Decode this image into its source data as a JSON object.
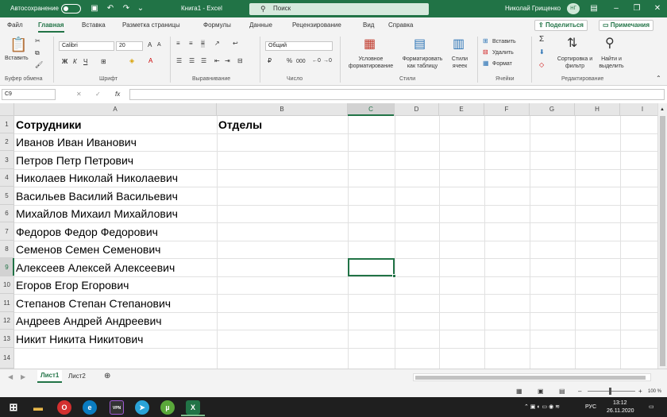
{
  "titlebar": {
    "autosave_label": "Автосохранение",
    "doc_title": "Книга1  -  Excel",
    "search_placeholder": "Поиск",
    "user_name": "Николай Грищенко",
    "user_initials": "НГ"
  },
  "tabs": [
    "Файл",
    "Главная",
    "Вставка",
    "Разметка страницы",
    "Формулы",
    "Данные",
    "Рецензирование",
    "Вид",
    "Справка"
  ],
  "active_tab": "Главная",
  "share_button": "Поделиться",
  "comments_button": "Примечания",
  "ribbon": {
    "clipboard": {
      "paste_label": "Вставить",
      "group_label": "Буфер обмена"
    },
    "font": {
      "name": "Calibri",
      "size": "20",
      "bold": "Ж",
      "italic": "К",
      "underline": "Ч",
      "group_label": "Шрифт"
    },
    "alignment": {
      "group_label": "Выравнивание"
    },
    "number": {
      "format": "Общий",
      "group_label": "Число",
      "percent": "%",
      "thousands": "000"
    },
    "styles": {
      "conditional": "Условное форматирование",
      "as_table": "Форматировать как таблицу",
      "cell_styles": "Стили ячеек",
      "group_label": "Стили"
    },
    "cells": {
      "insert": "Вставить",
      "delete": "Удалить",
      "format": "Формат",
      "group_label": "Ячейки"
    },
    "editing": {
      "sort": "Сортировка и фильтр",
      "find": "Найти и выделить",
      "group_label": "Редактирование"
    }
  },
  "formula_bar": {
    "name_box": "C9",
    "fx": "fx",
    "content": ""
  },
  "columns": [
    "A",
    "B",
    "C",
    "D",
    "E",
    "F",
    "G",
    "H",
    "I"
  ],
  "selected_column": "C",
  "rows": [
    "1",
    "2",
    "3",
    "4",
    "5",
    "6",
    "7",
    "8",
    "9",
    "10",
    "11",
    "12",
    "13",
    "14"
  ],
  "selected_row": "9",
  "cells": {
    "A1": "Сотрудники",
    "B1": "Отделы",
    "A": [
      "Иванов Иван Иванович",
      "Петров Петр Петрович",
      "Николаев Николай Николаевич",
      "Васильев Василий Васильевич",
      "Михайлов Михаил Михайлович",
      "Федоров Федор Федорович",
      "Семенов Семен Семенович",
      "Алексеев Алексей Алексеевич",
      "Егоров Егор Егорович",
      "Степанов Степан Степанович",
      "Андреев Андрей Андреевич",
      "Никит Никита Никитович"
    ]
  },
  "sheets": [
    "Лист1",
    "Лист2"
  ],
  "active_sheet": "Лист1",
  "status": {
    "zoom": "100 %"
  },
  "taskbar": {
    "lang": "РУС",
    "time": "13:12",
    "date": "26.11.2020"
  },
  "colors": {
    "accent": "#217346"
  }
}
